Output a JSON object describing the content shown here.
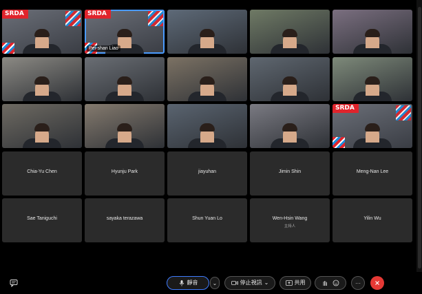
{
  "participants": [
    {
      "name": "",
      "srda": true,
      "video": true
    },
    {
      "name": "Pei-shan Liao",
      "srda": true,
      "video": true,
      "active": true
    },
    {
      "name": "",
      "video": true
    },
    {
      "name": "",
      "video": true
    },
    {
      "name": "",
      "video": true
    },
    {
      "name": "",
      "video": true
    },
    {
      "name": "",
      "video": true
    },
    {
      "name": "",
      "video": true
    },
    {
      "name": "",
      "video": true
    },
    {
      "name": "",
      "video": true
    },
    {
      "name": "",
      "video": true
    },
    {
      "name": "",
      "video": true
    },
    {
      "name": "",
      "video": true
    },
    {
      "name": "",
      "video": true
    },
    {
      "name": "",
      "srda": true,
      "video": true
    },
    {
      "name": "Chia-Yu Chen"
    },
    {
      "name": "Hyunju Park"
    },
    {
      "name": "jiayuhan"
    },
    {
      "name": "Jimin Shin"
    },
    {
      "name": "Meng-Nan Lee"
    },
    {
      "name": "Sae Taniguchi"
    },
    {
      "name": "sayaka terazawa"
    },
    {
      "name": "Shun Yuan Lo"
    },
    {
      "name": "Wen-Hsin Wang",
      "role": "主持人"
    },
    {
      "name": "Yilin Wu"
    }
  ],
  "srda_logo": "SRDA",
  "toolbar": {
    "mute_label": "靜音",
    "stop_video_label": "停止視訊",
    "share_label": "共用",
    "more_label": "···"
  },
  "colors": {
    "srda_blue": "#1a8fe0",
    "srda_red": "#e0242c",
    "end_call": "#e53935",
    "active_outline": "#4a9bff"
  }
}
